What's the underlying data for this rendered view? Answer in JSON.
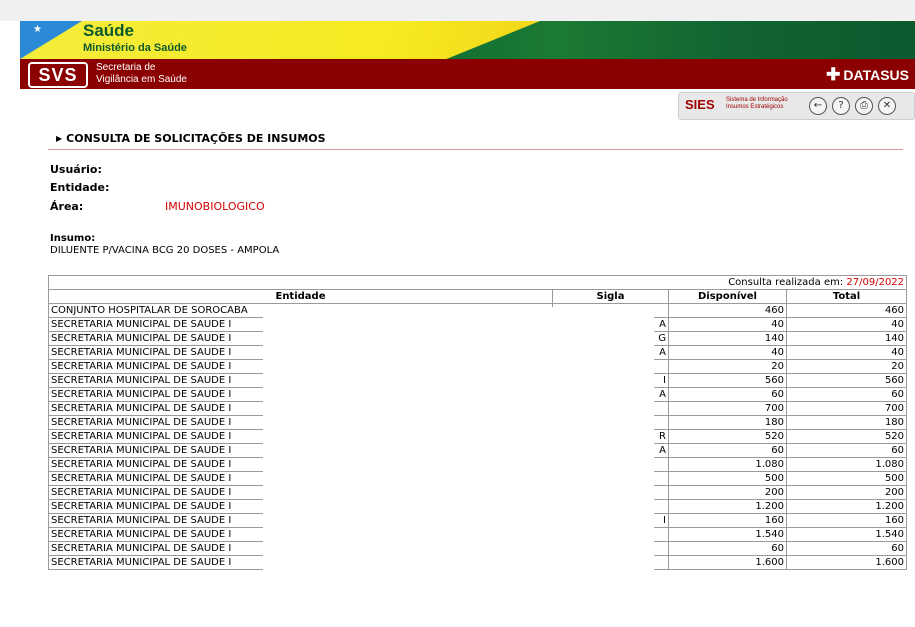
{
  "header": {
    "saude_title": "Saúde",
    "ministerio": "Ministério da Saúde",
    "svs_logo": "SVS",
    "svs_line1": "Secretaria de",
    "svs_line2": "Vigilância em Saúde",
    "datasus": "DATASUS",
    "sies_logo": "SIES",
    "sies_line1": "Sistema de Informação",
    "sies_line2": "Insumos Estratégicos",
    "icons": [
      "back-icon",
      "help-icon",
      "print-icon",
      "close-icon"
    ]
  },
  "section_title": "CONSULTA DE SOLICITAÇÕES DE INSUMOS",
  "info": {
    "usuario_label": "Usuário:",
    "entidade_label": "Entidade:",
    "area_label": "Área:",
    "area_value": "IMUNOBIOLOGICO"
  },
  "insumo": {
    "label": "Insumo:",
    "value": "DILUENTE P/VACINA BCG 20 DOSES - AMPOLA"
  },
  "table": {
    "caption_prefix": "Consulta realizada em: ",
    "caption_date": "27/09/2022",
    "headers": [
      "Entidade",
      "Sigla",
      "Disponível",
      "Total"
    ],
    "rows": [
      {
        "entidade": "CONJUNTO HOSPITALAR DE SOROCABA",
        "sigla": "",
        "disponivel": "460",
        "total": "460"
      },
      {
        "entidade": "SECRETARIA MUNICIPAL DE SAUDE I",
        "sigla": "A",
        "disponivel": "40",
        "total": "40"
      },
      {
        "entidade": "SECRETARIA MUNICIPAL DE SAUDE I",
        "sigla": "G",
        "disponivel": "140",
        "total": "140"
      },
      {
        "entidade": "SECRETARIA MUNICIPAL DE SAUDE I",
        "sigla": "A",
        "disponivel": "40",
        "total": "40"
      },
      {
        "entidade": "SECRETARIA MUNICIPAL DE SAUDE I",
        "sigla": "",
        "disponivel": "20",
        "total": "20"
      },
      {
        "entidade": "SECRETARIA MUNICIPAL DE SAUDE I",
        "sigla": "I",
        "disponivel": "560",
        "total": "560"
      },
      {
        "entidade": "SECRETARIA MUNICIPAL DE SAUDE I",
        "sigla": "A",
        "disponivel": "60",
        "total": "60"
      },
      {
        "entidade": "SECRETARIA MUNICIPAL DE SAUDE I",
        "sigla": "",
        "disponivel": "700",
        "total": "700"
      },
      {
        "entidade": "SECRETARIA MUNICIPAL DE SAUDE I",
        "sigla": "",
        "disponivel": "180",
        "total": "180"
      },
      {
        "entidade": "SECRETARIA MUNICIPAL DE SAUDE I",
        "sigla": "R",
        "disponivel": "520",
        "total": "520"
      },
      {
        "entidade": "SECRETARIA MUNICIPAL DE SAUDE I",
        "sigla": "A",
        "disponivel": "60",
        "total": "60"
      },
      {
        "entidade": "SECRETARIA MUNICIPAL DE SAUDE I",
        "sigla": "",
        "disponivel": "1.080",
        "total": "1.080"
      },
      {
        "entidade": "SECRETARIA MUNICIPAL DE SAUDE I",
        "sigla": "",
        "disponivel": "500",
        "total": "500"
      },
      {
        "entidade": "SECRETARIA MUNICIPAL DE SAUDE I",
        "sigla": "",
        "disponivel": "200",
        "total": "200"
      },
      {
        "entidade": "SECRETARIA MUNICIPAL DE SAUDE I",
        "sigla": "",
        "disponivel": "1.200",
        "total": "1.200"
      },
      {
        "entidade": "SECRETARIA MUNICIPAL DE SAUDE I",
        "sigla": "I",
        "disponivel": "160",
        "total": "160"
      },
      {
        "entidade": "SECRETARIA MUNICIPAL DE SAUDE I",
        "sigla": "",
        "disponivel": "1.540",
        "total": "1.540"
      },
      {
        "entidade": "SECRETARIA MUNICIPAL DE SAUDE I",
        "sigla": "",
        "disponivel": "60",
        "total": "60"
      },
      {
        "entidade": "SECRETARIA MUNICIPAL DE SAUDE I",
        "sigla": "",
        "disponivel": "1.600",
        "total": "1.600"
      }
    ]
  }
}
